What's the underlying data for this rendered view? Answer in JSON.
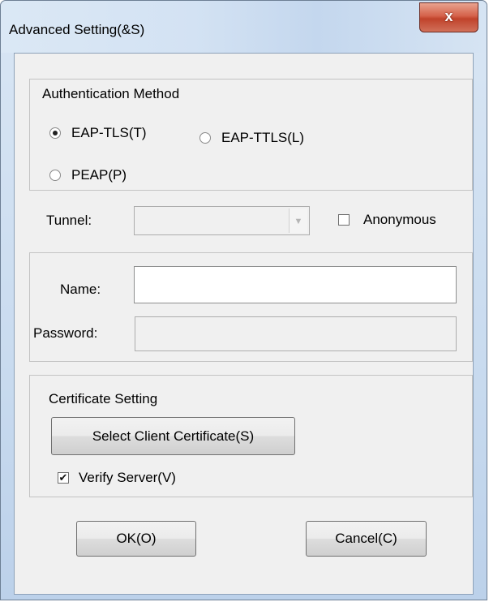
{
  "window": {
    "title": "Advanced Setting(&S)",
    "close_glyph": "x"
  },
  "auth": {
    "group_label": "Authentication Method",
    "options": [
      {
        "label": "EAP-TLS(T)",
        "selected": true
      },
      {
        "label": "EAP-TTLS(L)",
        "selected": false
      },
      {
        "label": "PEAP(P)",
        "selected": false
      }
    ]
  },
  "tunnel": {
    "label": "Tunnel:",
    "value": "",
    "enabled": false
  },
  "anonymous": {
    "label": "Anonymous",
    "checked": false
  },
  "credentials": {
    "name_label": "Name:",
    "name_value": "",
    "password_label": "Password:",
    "password_value": ""
  },
  "certificate": {
    "group_label": "Certificate Setting",
    "select_button": "Select Client Certificate(S)",
    "verify_label": "Verify Server(V)",
    "verify_checked": true
  },
  "buttons": {
    "ok": "OK(O)",
    "cancel": "Cancel(C)"
  },
  "icons": {
    "close": "close-icon",
    "dropdown": "chevron-down-icon"
  }
}
